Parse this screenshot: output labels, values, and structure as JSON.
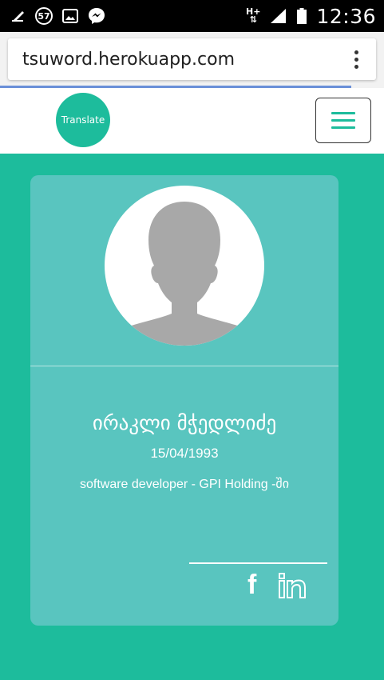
{
  "status_bar": {
    "badge_number": "57",
    "network_label": "H+",
    "time": "12:36",
    "icons": [
      "notification-icon",
      "image-icon",
      "messenger-icon",
      "signal-icon",
      "battery-icon"
    ]
  },
  "browser": {
    "url": "tsuword.herokuapp.com",
    "menu_icon": "more-vert-icon"
  },
  "navbar": {
    "logo_text": "Translate",
    "menu_icon": "hamburger-icon"
  },
  "profile": {
    "name": "ირაკლი მჭედლიძე",
    "birth_date": "15/04/1993",
    "occupation": "software developer - GPI Holding -ში",
    "social": {
      "facebook_label": "f",
      "linkedin_label": "in"
    }
  },
  "colors": {
    "accent": "#1dbc9c",
    "card": "#59c5bf",
    "avatar_silhouette": "#a8a8a8"
  }
}
